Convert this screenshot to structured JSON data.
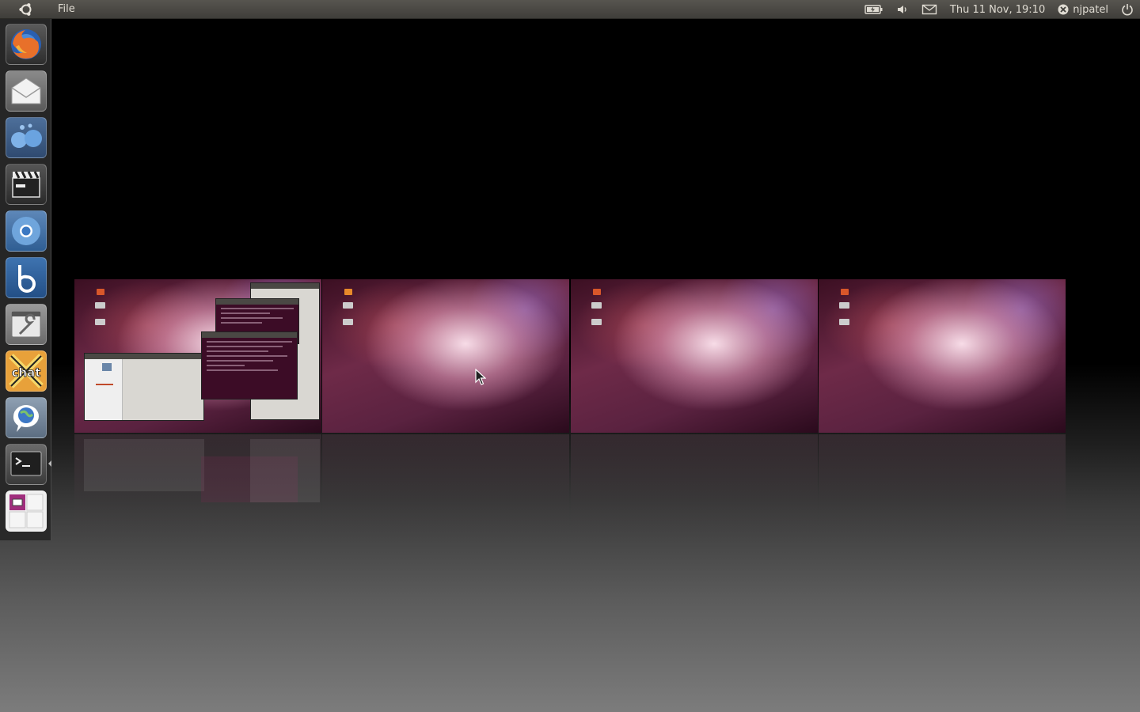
{
  "top_panel": {
    "menu": {
      "file_label": "File"
    },
    "indicators": {
      "datetime": "Thu 11 Nov, 19:10",
      "username": "njpatel"
    }
  },
  "launcher": {
    "items": [
      {
        "name": "firefox",
        "icon": "firefox-icon"
      },
      {
        "name": "mail",
        "icon": "mail-envelope-icon"
      },
      {
        "name": "empathy",
        "icon": "chat-bubbles-icon"
      },
      {
        "name": "movie-player",
        "icon": "clapperboard-icon"
      },
      {
        "name": "chromium",
        "icon": "chromium-icon"
      },
      {
        "name": "banshee",
        "icon": "banshee-icon"
      },
      {
        "name": "system-settings",
        "icon": "settings-wrench-icon"
      },
      {
        "name": "xchat",
        "icon": "xchat-icon"
      },
      {
        "name": "web-chat",
        "icon": "globe-chat-icon"
      },
      {
        "name": "terminal",
        "icon": "terminal-icon"
      },
      {
        "name": "workspace-switcher",
        "icon": "workspaces-icon"
      }
    ]
  },
  "workspaces": {
    "count": 4,
    "items": [
      {
        "id": 1,
        "has_windows": true
      },
      {
        "id": 2,
        "has_windows": false
      },
      {
        "id": 3,
        "has_windows": false
      },
      {
        "id": 4,
        "has_windows": false
      }
    ]
  },
  "colors": {
    "panel_bg": "#3f3e3a",
    "wallpaper_primary": "#6e2a48",
    "terminal_bg": "#3c0c26"
  }
}
